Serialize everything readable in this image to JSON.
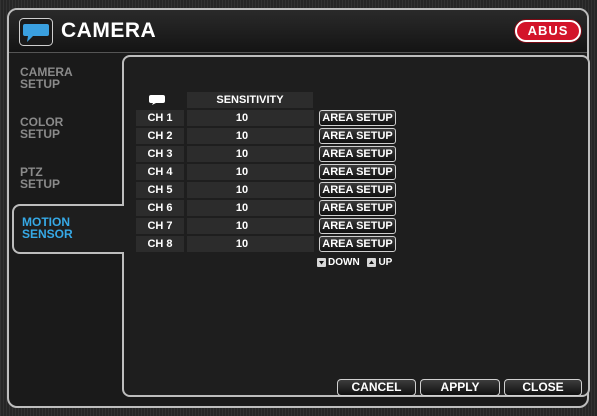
{
  "title": "CAMERA",
  "logo_text": "ABUS",
  "colors": {
    "accent": "#36a9e6",
    "logo_red": "#d3142a"
  },
  "sidebar": {
    "items": [
      {
        "line1": "CAMERA",
        "line2": "SETUP"
      },
      {
        "line1": "COLOR",
        "line2": "SETUP"
      },
      {
        "line1": "PTZ",
        "line2": "SETUP"
      },
      {
        "line1": "MOTION",
        "line2": "SENSOR"
      }
    ],
    "active_index": 3
  },
  "table": {
    "header_icon": "speech-bubble-icon",
    "sensitivity_header": "SENSITIVITY",
    "area_button_label": "AREA SETUP",
    "rows": [
      {
        "channel": "CH 1",
        "value": "10"
      },
      {
        "channel": "CH 2",
        "value": "10"
      },
      {
        "channel": "CH 3",
        "value": "10"
      },
      {
        "channel": "CH 4",
        "value": "10"
      },
      {
        "channel": "CH 5",
        "value": "10"
      },
      {
        "channel": "CH 6",
        "value": "10"
      },
      {
        "channel": "CH 7",
        "value": "10"
      },
      {
        "channel": "CH 8",
        "value": "10"
      }
    ]
  },
  "legend": {
    "down": "DOWN",
    "up": "UP"
  },
  "buttons": {
    "cancel": "CANCEL",
    "apply": "APPLY",
    "close": "CLOSE"
  }
}
